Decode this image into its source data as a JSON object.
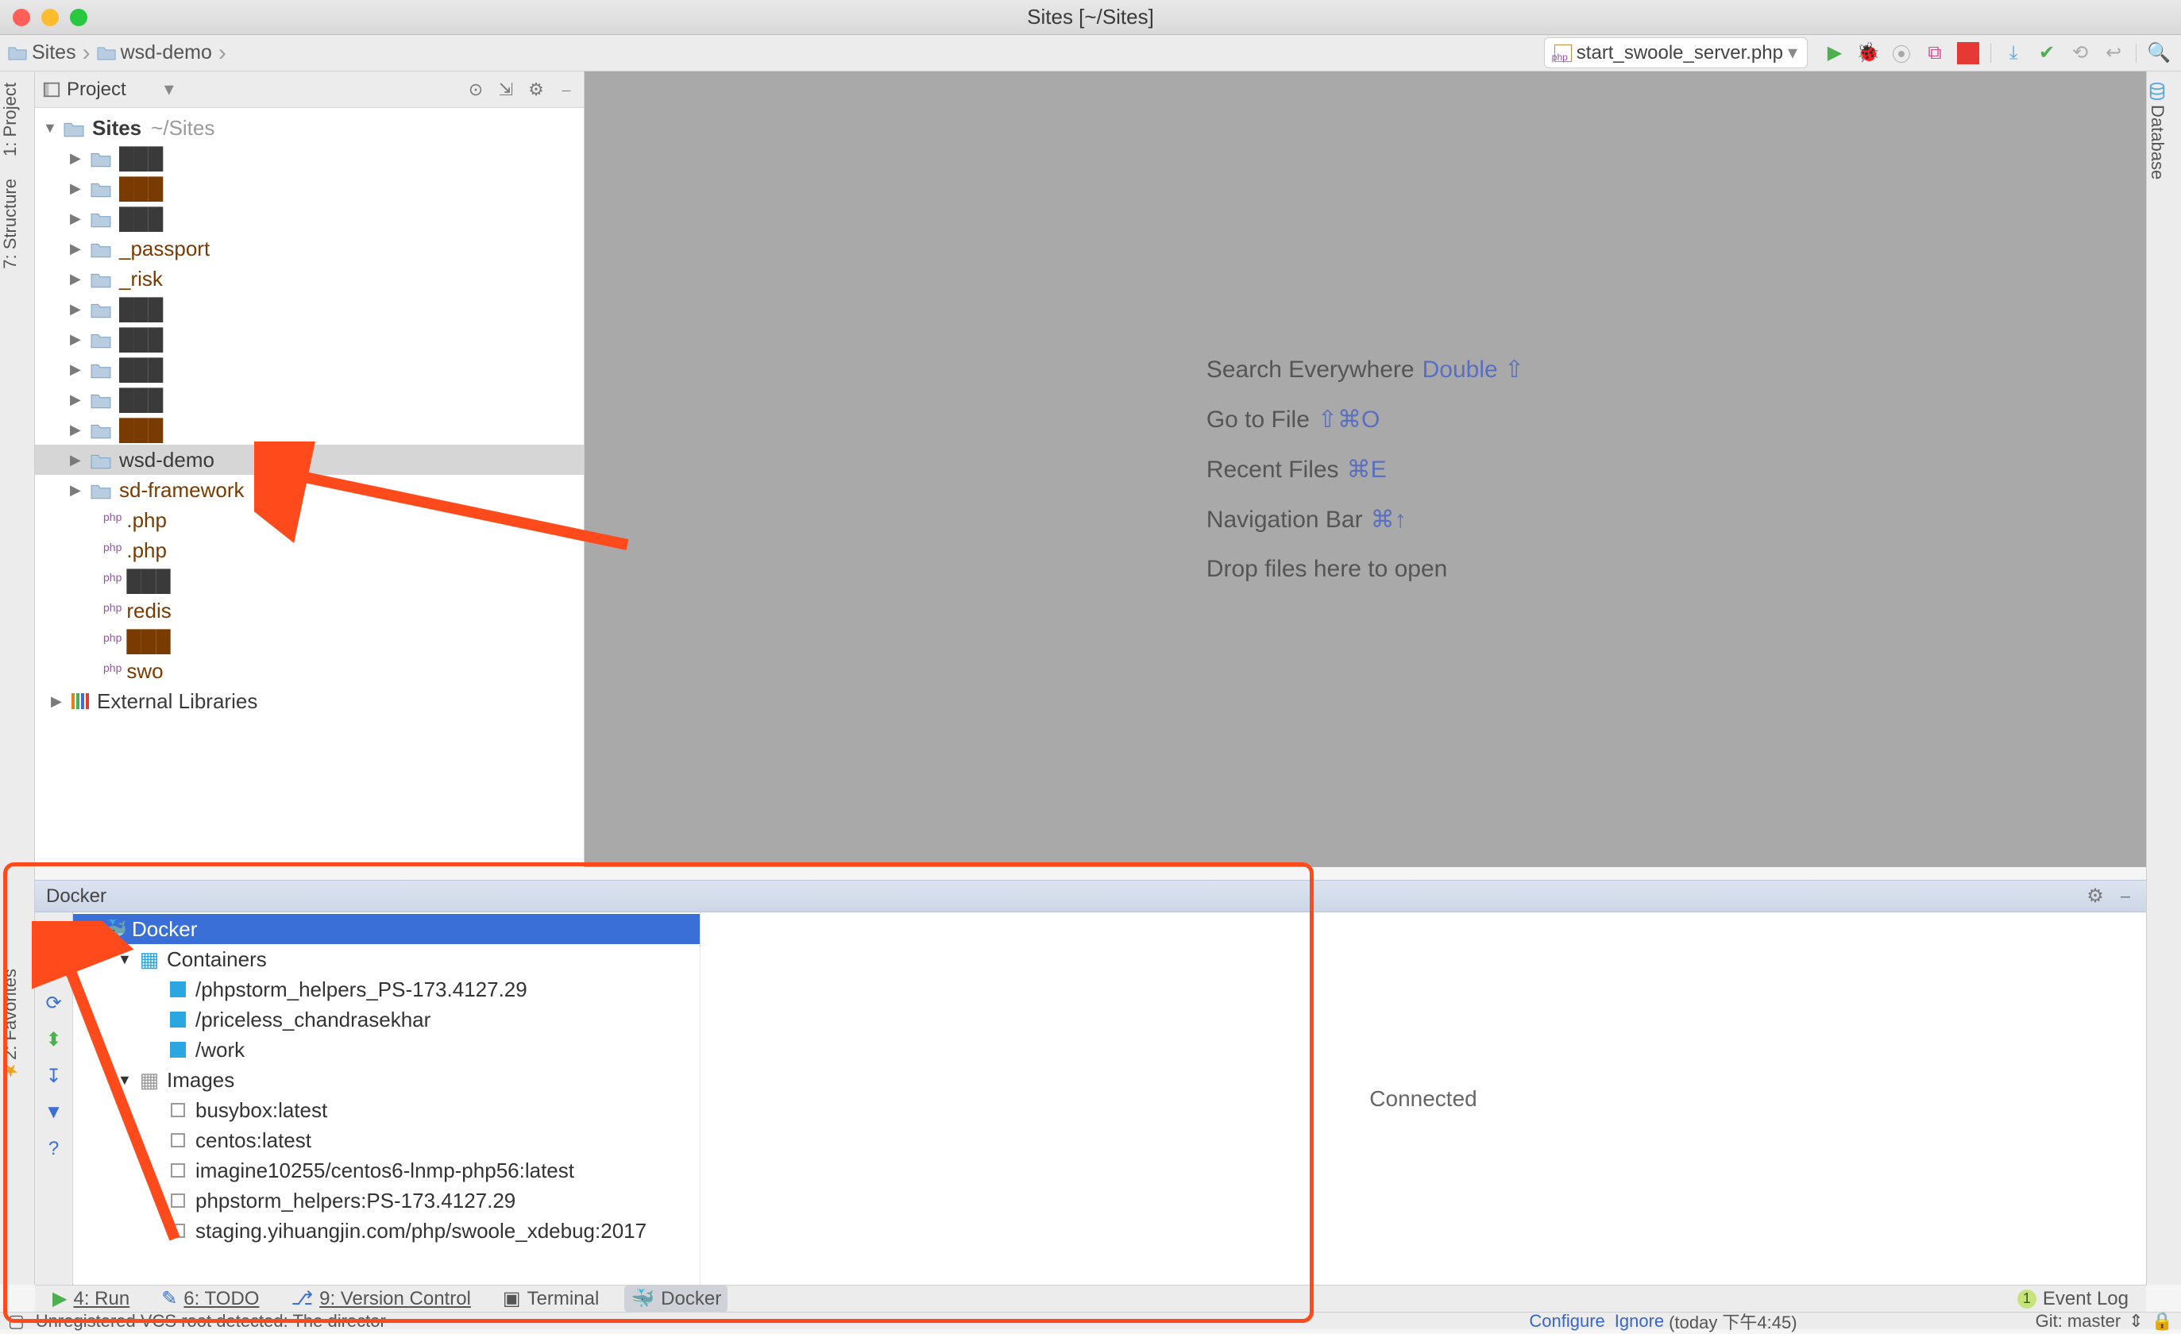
{
  "window": {
    "title": "Sites [~/Sites]"
  },
  "breadcrumbs": [
    {
      "label": "Sites"
    },
    {
      "label": "wsd-demo"
    }
  ],
  "runconfig": {
    "label": "start_swoole_server.php"
  },
  "leftTabs": {
    "project": "1: Project",
    "structure": "7: Structure",
    "favorites": "2: Favorites"
  },
  "rightTabs": {
    "database": "Database"
  },
  "projectPanel": {
    "title": "Project",
    "root": {
      "name": "Sites",
      "path": "~/Sites"
    },
    "items": [
      {
        "name": "",
        "dirty": false
      },
      {
        "name": "",
        "dirty": true
      },
      {
        "name": "",
        "dirty": false
      },
      {
        "name": "_passport",
        "dirty": true
      },
      {
        "name": "_risk",
        "dirty": true
      },
      {
        "name": "",
        "dirty": false
      },
      {
        "name": "",
        "dirty": false
      },
      {
        "name": "",
        "dirty": false
      },
      {
        "name": "",
        "dirty": false
      },
      {
        "name": "",
        "dirty": true
      },
      {
        "name": "wsd-demo",
        "selected": true
      },
      {
        "name": "sd-framework",
        "dirty": true
      }
    ],
    "files": [
      {
        "name": ".php",
        "dirty": true
      },
      {
        "name": ".php",
        "dirty": true
      },
      {
        "name": "",
        "dirty": false
      },
      {
        "name": "redis",
        "dirty": true
      },
      {
        "name": "",
        "dirty": true
      },
      {
        "name": "swo",
        "dirty": true
      }
    ],
    "external": "External Libraries"
  },
  "emptyEditor": {
    "l1a": "Search Everywhere",
    "l1b": "Double ⇧",
    "l2a": "Go to File",
    "l2b": "⇧⌘O",
    "l3a": "Recent Files",
    "l3b": "⌘E",
    "l4a": "Navigation Bar",
    "l4b": "⌘↑",
    "l5": "Drop files here to open"
  },
  "docker": {
    "title": "Docker",
    "root": "Docker",
    "containersLabel": "Containers",
    "containers": [
      "/phpstorm_helpers_PS-173.4127.29",
      "/priceless_chandrasekhar",
      "/work"
    ],
    "imagesLabel": "Images",
    "images": [
      "busybox:latest",
      "centos:latest",
      "imagine10255/centos6-lnmp-php56:latest",
      "phpstorm_helpers:PS-173.4127.29",
      "staging.yihuangjin.com/php/swoole_xdebug:2017"
    ],
    "status": "Connected"
  },
  "bottomTabs": {
    "run": "4: Run",
    "todo": "6: TODO",
    "vcs": "9: Version Control",
    "terminal": "Terminal",
    "docker": "Docker",
    "eventLog": "Event Log"
  },
  "statusbar": {
    "msg": "Unregistered VCS root detected: The director",
    "configure": "Configure",
    "ignore": "Ignore",
    "time": "(today 下午4:45)",
    "git": "Git: master"
  }
}
